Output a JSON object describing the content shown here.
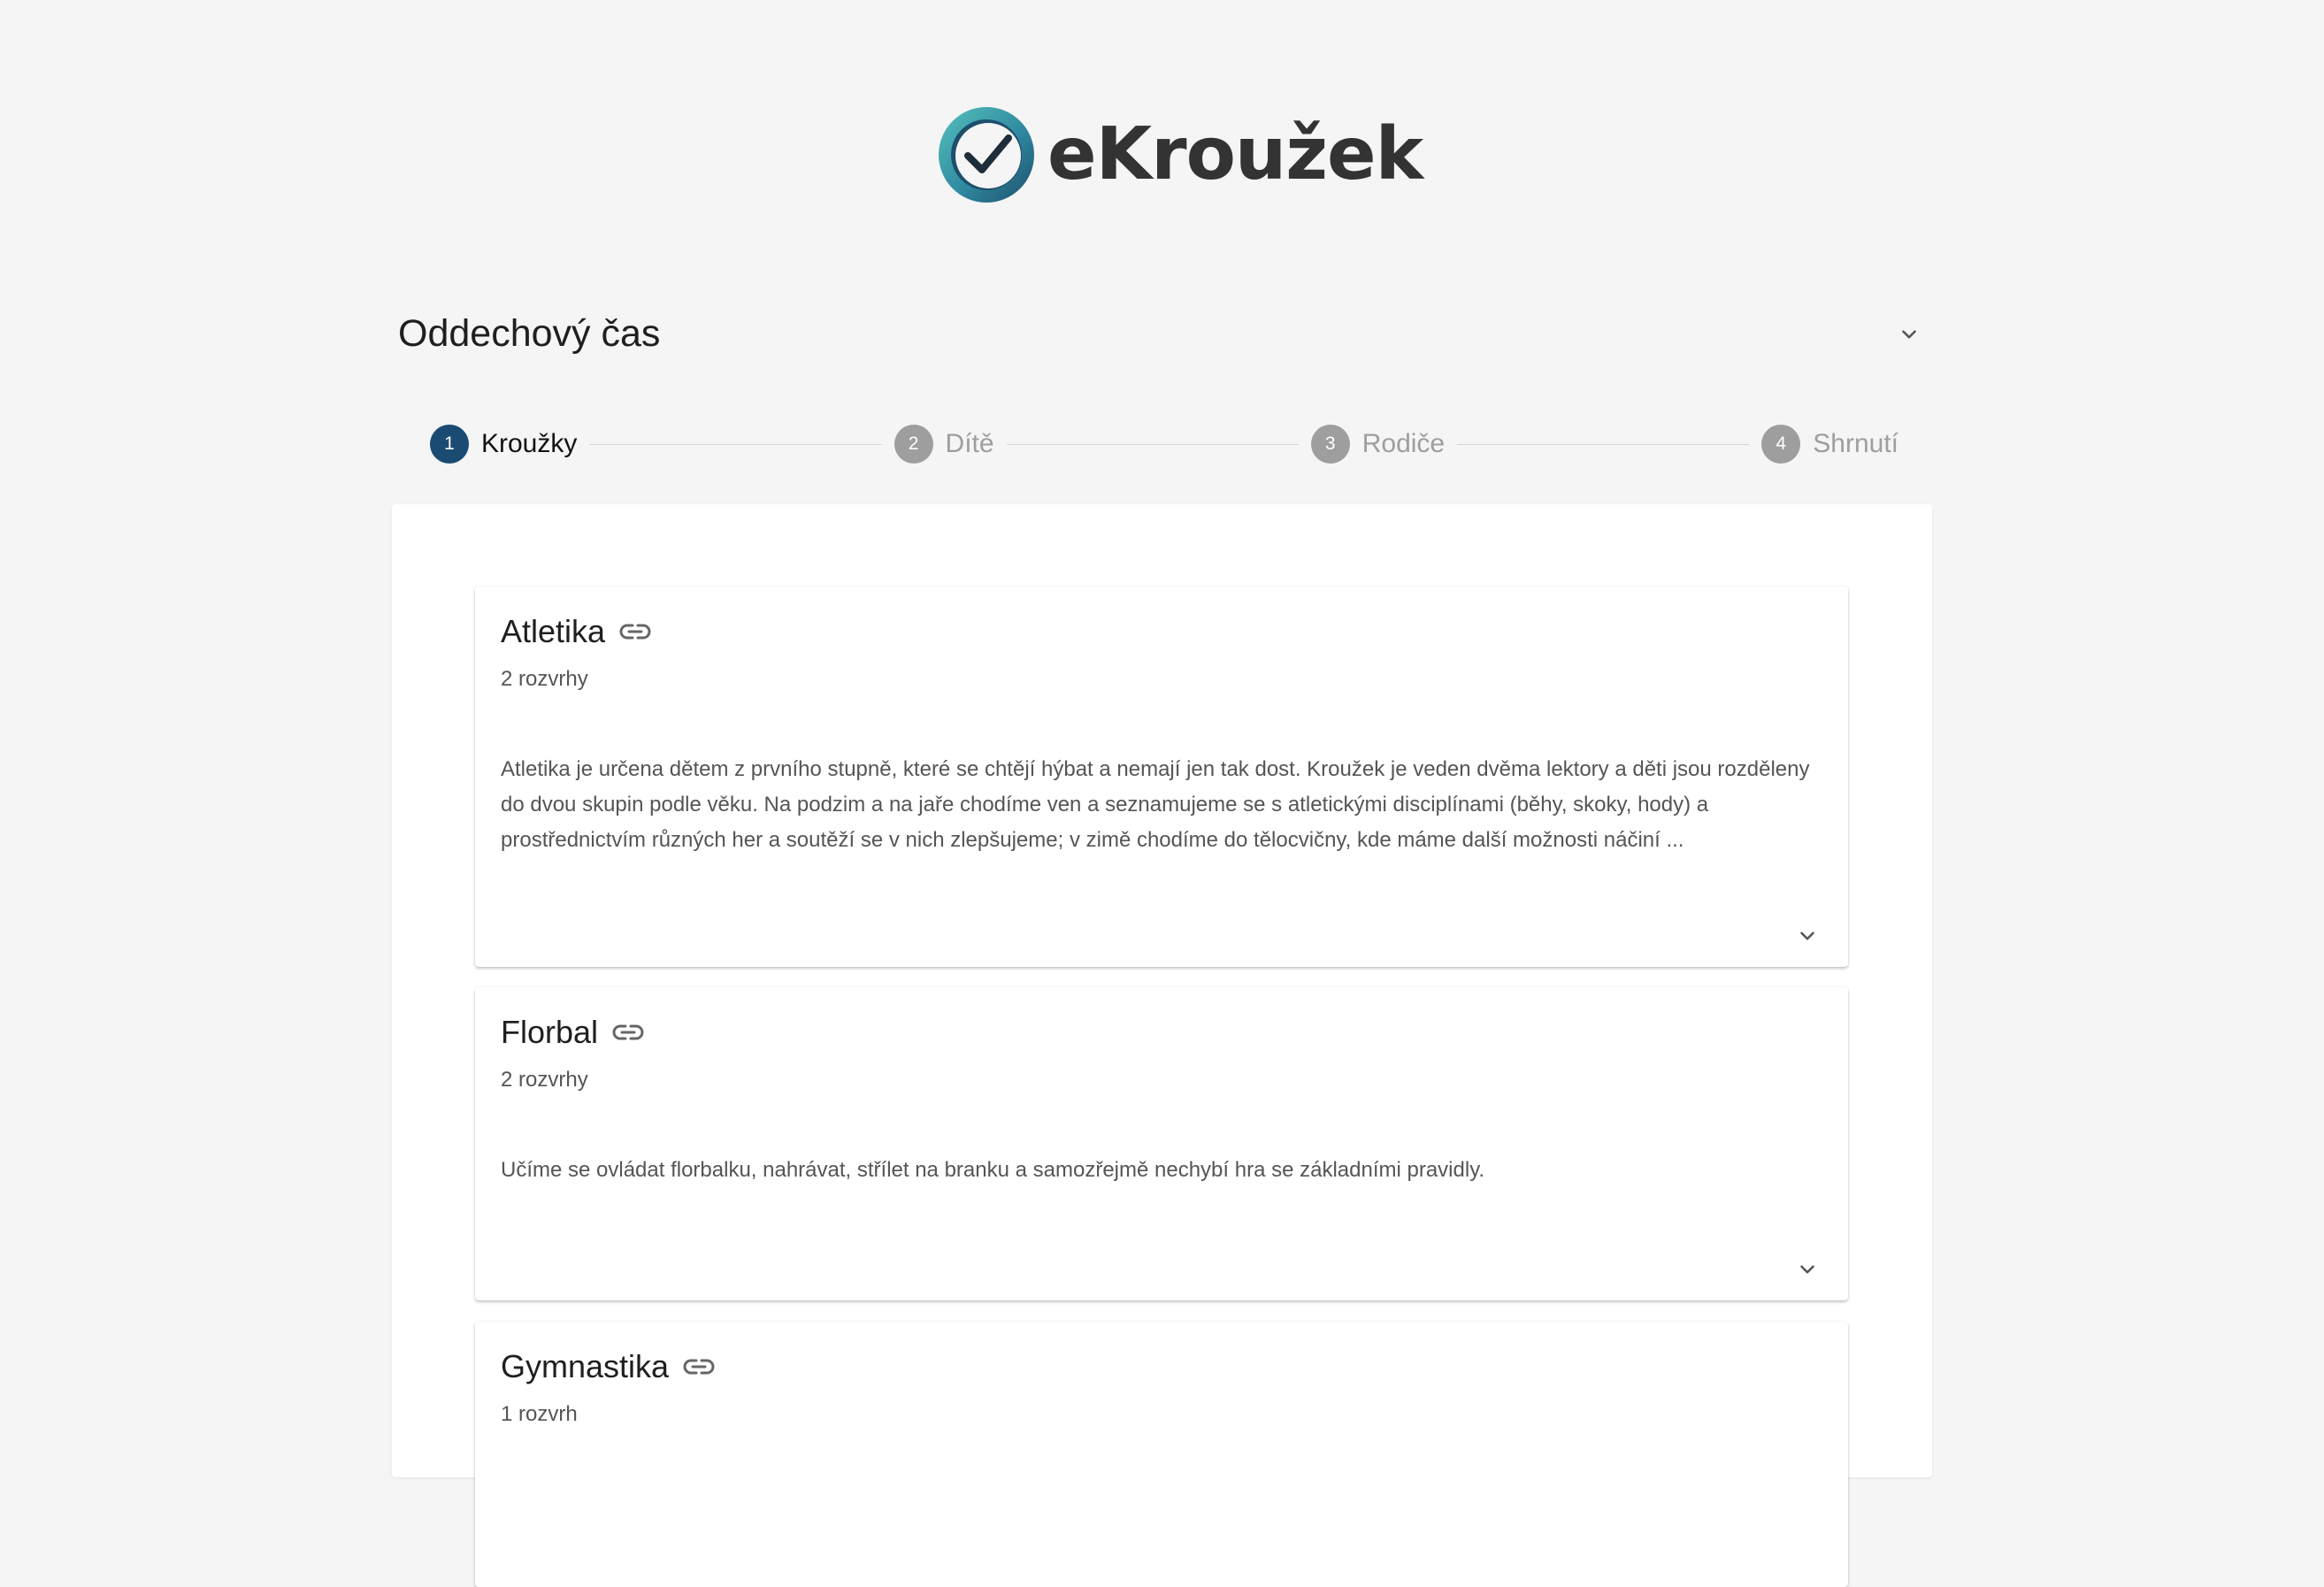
{
  "brand": {
    "name": "eKroužek",
    "logo_icon": "check-circle-logo",
    "colors": {
      "logo_dark": "#1e4e6c",
      "logo_light": "#4fb9b5"
    }
  },
  "section": {
    "title": "Oddechový čas",
    "toggle_icon": "chevron-down-icon"
  },
  "stepper": {
    "steps": [
      {
        "number": "1",
        "label": "Kroužky",
        "active": true
      },
      {
        "number": "2",
        "label": "Dítě",
        "active": false
      },
      {
        "number": "3",
        "label": "Rodiče",
        "active": false
      },
      {
        "number": "4",
        "label": "Shrnutí",
        "active": false
      }
    ],
    "colors": {
      "active": "#1b4a73",
      "inactive": "#9e9e9e"
    }
  },
  "clubs": [
    {
      "title": "Atletika",
      "schedules": "2 rozvrhy",
      "description": "Atletika je určena dětem z prvního stupně, které se chtějí hýbat a nemají jen tak dost. Kroužek je veden dvěma lektory a děti jsou rozděleny do dvou skupin podle věku. Na podzim a na jaře chodíme ven a seznamujeme se s atletickými disciplínami (běhy, skoky, hody) a prostřednictvím různých her a soutěží se v nich zlepšujeme; v zimě chodíme do tělocvičny, kde máme další možnosti náčiní ..."
    },
    {
      "title": "Florbal",
      "schedules": "2 rozvrhy",
      "description": "Učíme se ovládat florbalku, nahrávat, střílet na branku a samozřejmě nechybí hra se základními pravidly."
    },
    {
      "title": "Gymnastika",
      "schedules": "1 rozvrh",
      "description": ""
    }
  ]
}
